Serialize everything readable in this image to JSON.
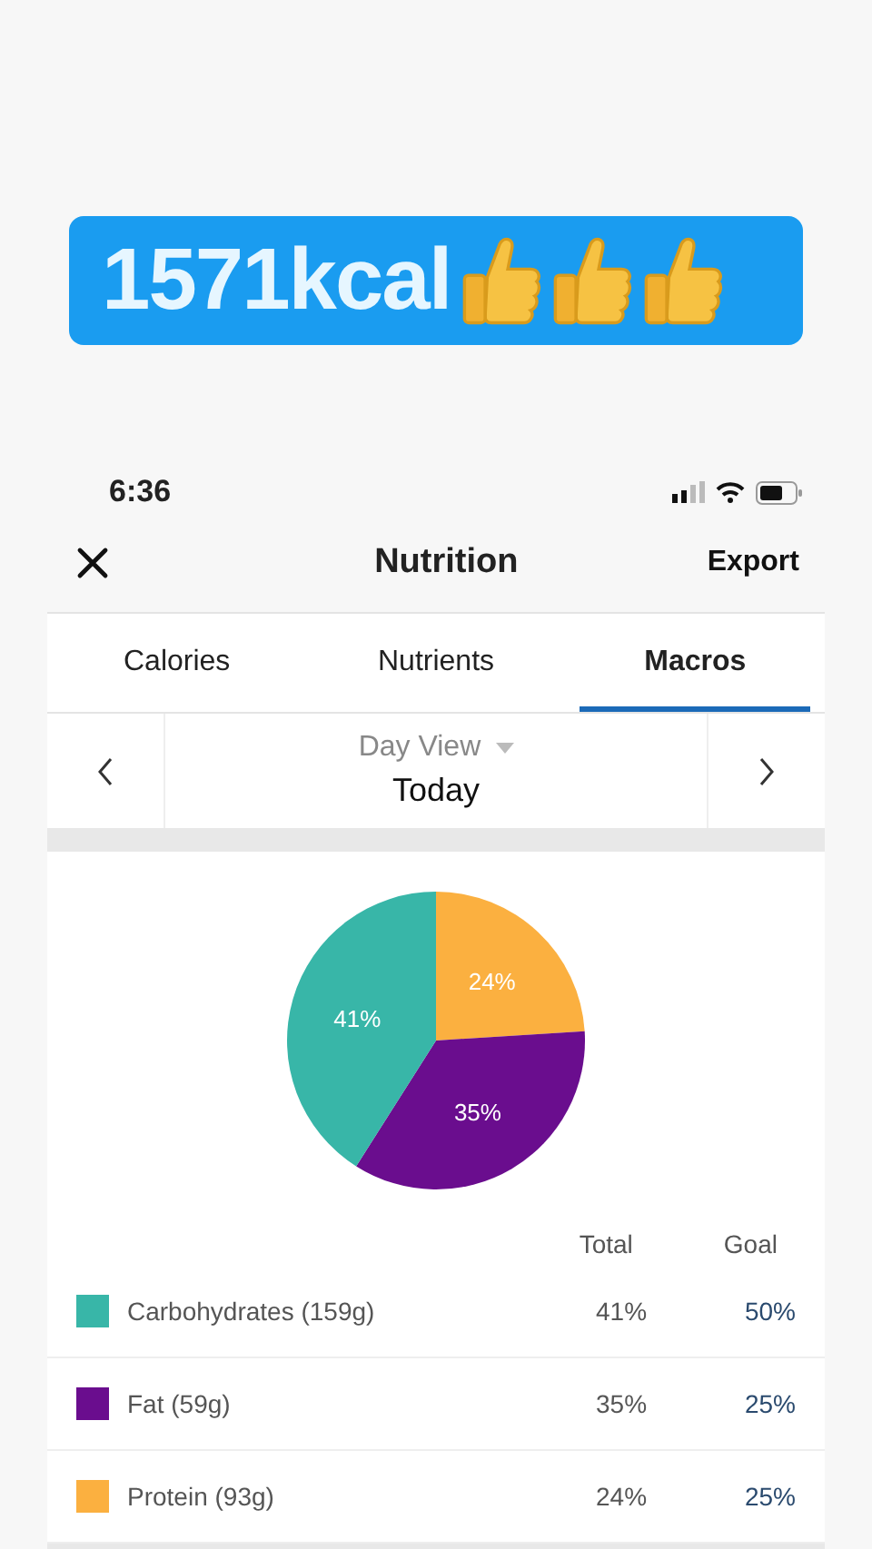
{
  "banner": {
    "text": "1571kcal"
  },
  "status_bar": {
    "time": "6:36"
  },
  "header": {
    "title": "Nutrition",
    "action": "Export"
  },
  "tabs": [
    {
      "label": "Calories",
      "selected": false
    },
    {
      "label": "Nutrients",
      "selected": false
    },
    {
      "label": "Macros",
      "selected": true
    }
  ],
  "date_nav": {
    "view": "Day View",
    "date": "Today"
  },
  "chart": {
    "chart_data": {
      "type": "pie",
      "values": [
        41,
        35,
        24
      ],
      "value_labels": [
        "41%",
        "35%",
        "24%"
      ]
    }
  },
  "table": {
    "columns": [
      "Total",
      "Goal"
    ],
    "rows": [
      {
        "name": "Carbohydrates (159g)",
        "color": "#38b6a8",
        "total": "41%",
        "goal": "50%"
      },
      {
        "name": "Fat (59g)",
        "color": "#6a0d8e",
        "total": "35%",
        "goal": "25%"
      },
      {
        "name": "Protein (93g)",
        "color": "#fbb040",
        "total": "24%",
        "goal": "25%"
      }
    ]
  }
}
